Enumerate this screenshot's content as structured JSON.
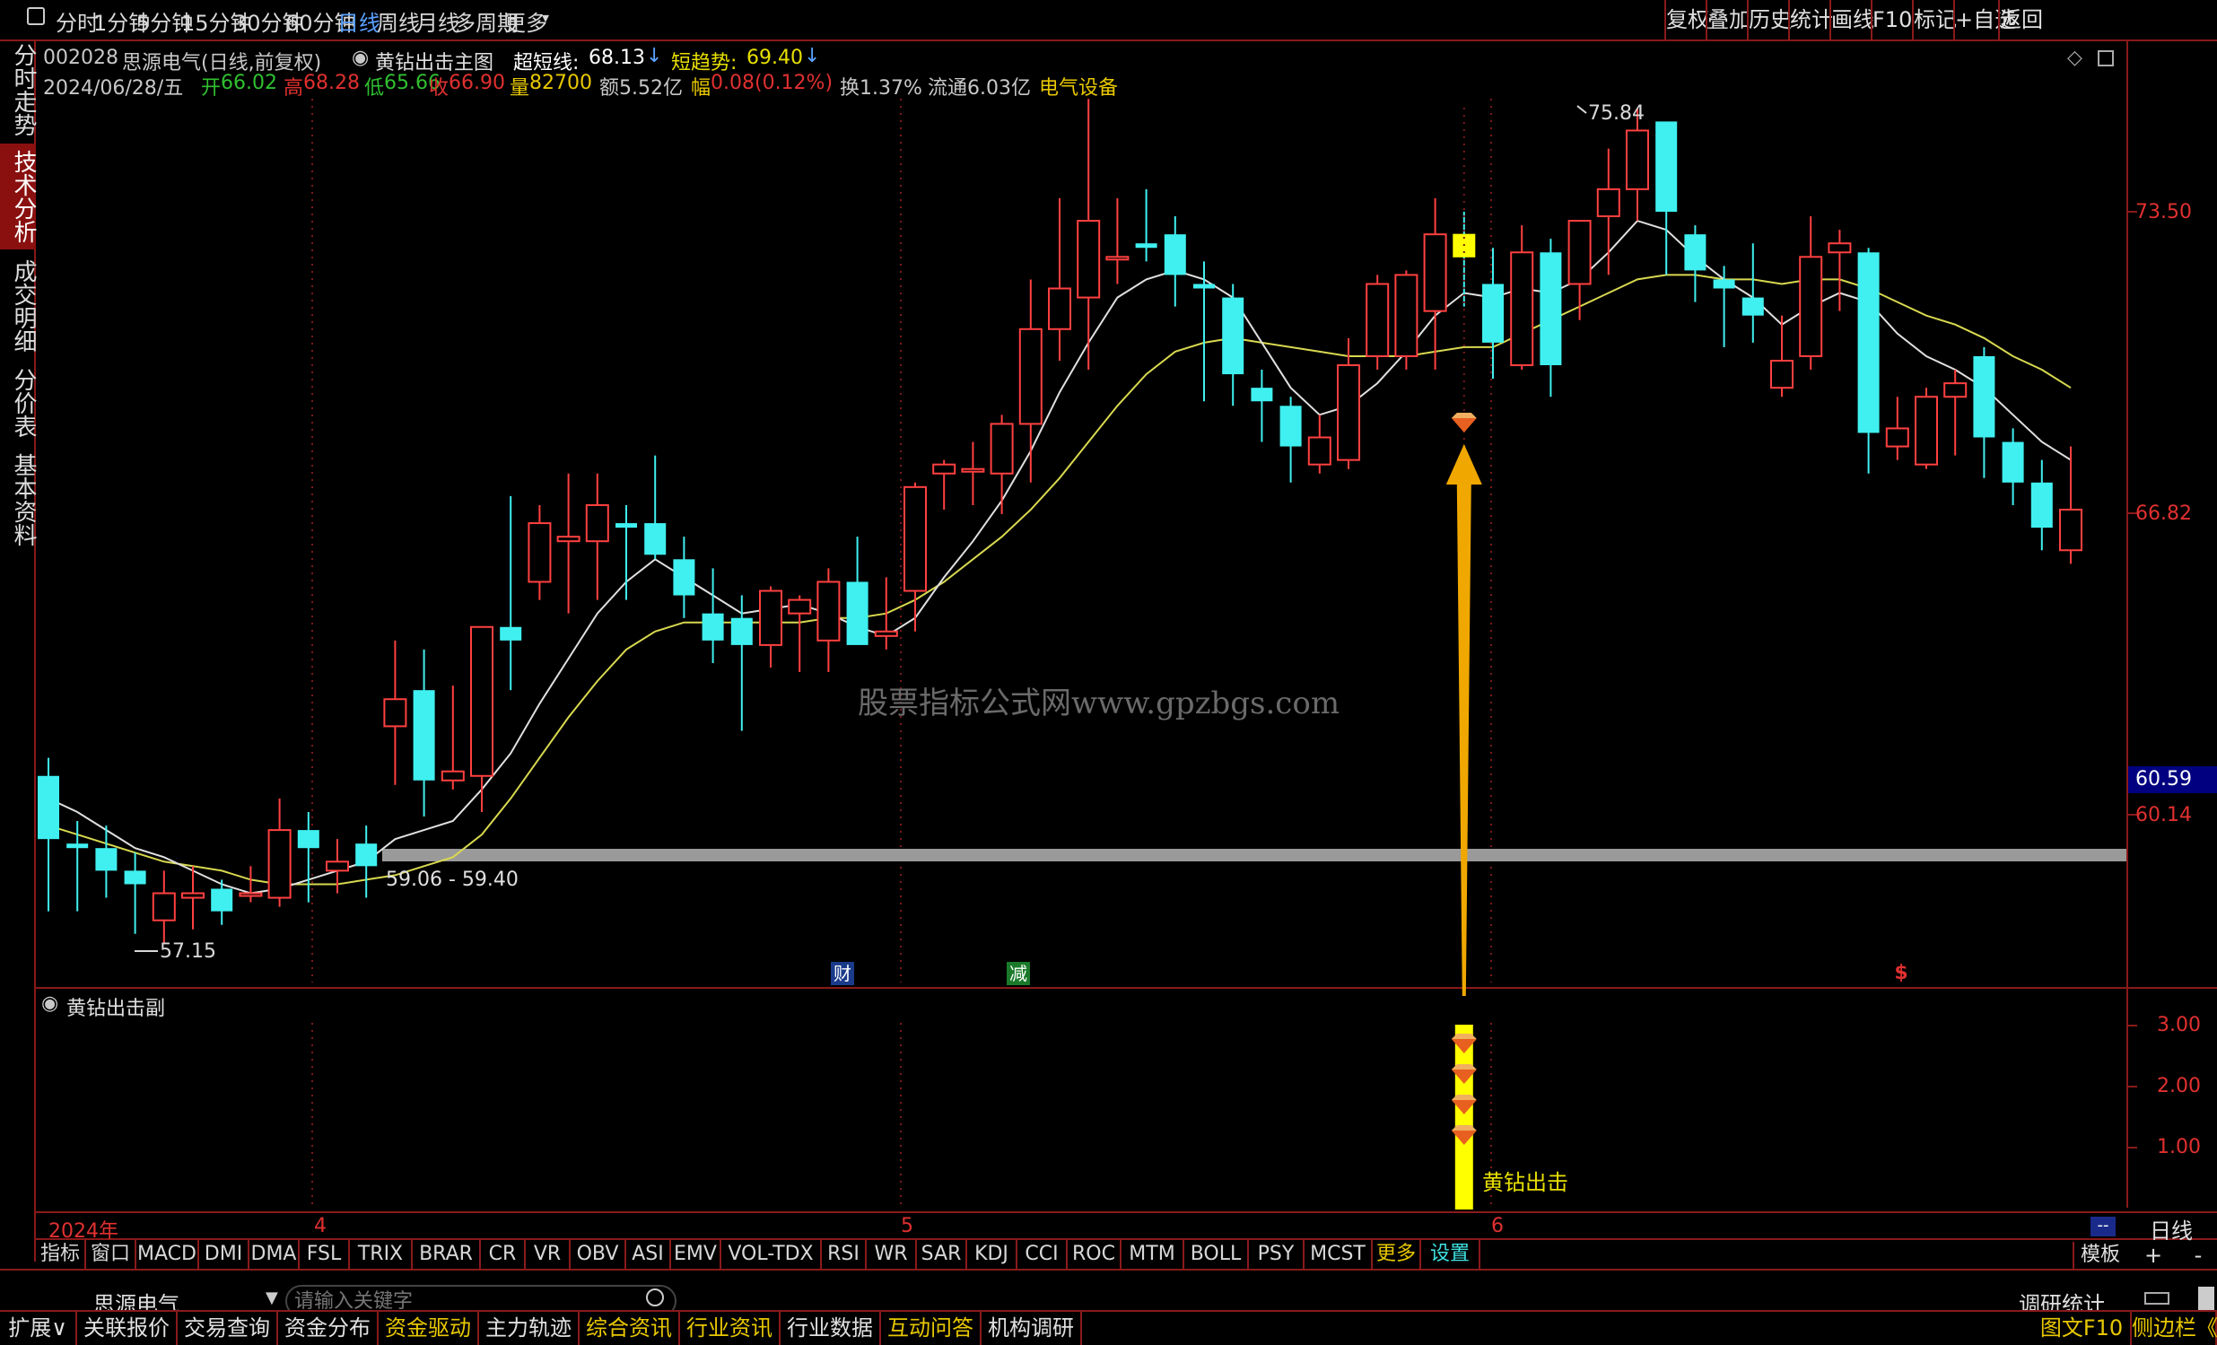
{
  "topbar": {
    "periods": [
      "分时",
      "1分钟",
      "5分钟",
      "15分钟",
      "30分钟",
      "60分钟",
      "日线",
      "周线",
      "月线",
      "多周期",
      "更多"
    ],
    "active_period": "日线",
    "more_arrow": "▾",
    "right_buttons": [
      "复权",
      "叠加",
      "历史",
      "统计",
      "画线",
      "F10",
      "标记",
      "+自选",
      "返回"
    ]
  },
  "sidebar": {
    "items": [
      "分时走势",
      "技术分析",
      "成交明细",
      "分价表",
      "基本资料"
    ],
    "active": "技术分析"
  },
  "stock": {
    "code": "002028",
    "name": "思源电气",
    "mode": "(日线,前复权)",
    "indicator": "黄钻出击主图",
    "ultra_short_label": "超短线:",
    "ultra_short_value": "68.13",
    "short_trend_label": "短趋势:",
    "short_trend_value": "69.40"
  },
  "quote": {
    "date": "2024/06/28/五",
    "open_label": "开",
    "open": "66.02",
    "high_label": "高",
    "high": "68.28",
    "low_label": "低",
    "low": "65.66",
    "close_label": "收",
    "close": "66.90",
    "vol_label": "量",
    "vol": "82700",
    "amount_label": "额",
    "amount": "5.52亿",
    "change_label": "幅",
    "change": "0.08(0.12%)",
    "turnover": "换1.37%",
    "float": "流通6.03亿",
    "sector": "电气设备"
  },
  "main_chart": {
    "y_labels": [
      "73.50",
      "66.82",
      "60.14"
    ],
    "current_price": "60.59",
    "high_marker": "75.84",
    "low_marker": "57.15",
    "range_label": "59.06 - 59.40",
    "watermark": "股票指标公式网www.gpzbgs.com",
    "event_tags": [
      "财",
      "减",
      "$"
    ]
  },
  "sub_chart": {
    "title": "黄钻出击副",
    "y_labels": [
      "3.00",
      "2.00",
      "1.00"
    ],
    "signal_label": "黄钻出击"
  },
  "time_axis": {
    "year": "2024年",
    "months": [
      "4",
      "5",
      "6"
    ],
    "period_label": "日线",
    "dash": "--"
  },
  "indicator_bar": {
    "items": [
      "指标",
      "窗口",
      "MACD",
      "DMI",
      "DMA",
      "FSL",
      "TRIX",
      "BRAR",
      "CR",
      "VR",
      "OBV",
      "ASI",
      "EMV",
      "VOL-TDX",
      "RSI",
      "WR",
      "SAR",
      "KDJ",
      "CCI",
      "ROC",
      "MTM",
      "BOLL",
      "PSY",
      "MCST",
      "更多",
      "设置"
    ],
    "template": "模板",
    "plus": "+",
    "minus": "-"
  },
  "search": {
    "stock_name": "思源电气",
    "placeholder": "请输入关键字",
    "right_label": "调研统计"
  },
  "bottom_tabs": {
    "expand": "扩展∨",
    "items": [
      "关联报价",
      "交易查询",
      "资金分布",
      "资金驱动",
      "主力轨迹",
      "综合资讯",
      "行业资讯",
      "行业数据",
      "互动问答",
      "机构调研"
    ],
    "right": [
      "图文F10",
      "侧边栏《"
    ]
  },
  "chart_data": {
    "type": "candlestick",
    "y_range": [
      56.5,
      77.0
    ],
    "candles": [
      {
        "o": 61.0,
        "h": 61.4,
        "l": 58.0,
        "c": 59.6
      },
      {
        "o": 59.5,
        "h": 60.0,
        "l": 58.0,
        "c": 59.4
      },
      {
        "o": 59.4,
        "h": 59.9,
        "l": 58.3,
        "c": 58.9
      },
      {
        "o": 58.9,
        "h": 59.3,
        "l": 57.5,
        "c": 58.6
      },
      {
        "o": 57.8,
        "h": 58.9,
        "l": 57.3,
        "c": 58.4
      },
      {
        "o": 58.3,
        "h": 59.0,
        "l": 57.6,
        "c": 58.4
      },
      {
        "o": 58.5,
        "h": 58.7,
        "l": 57.7,
        "c": 58.0
      },
      {
        "o": 58.4,
        "h": 59.0,
        "l": 58.2,
        "c": 58.4
      },
      {
        "o": 58.3,
        "h": 60.5,
        "l": 58.1,
        "c": 59.8
      },
      {
        "o": 59.8,
        "h": 60.2,
        "l": 58.2,
        "c": 59.4
      },
      {
        "o": 58.9,
        "h": 59.6,
        "l": 58.4,
        "c": 59.1
      },
      {
        "o": 59.5,
        "h": 59.9,
        "l": 58.3,
        "c": 59.0
      },
      {
        "o": 62.1,
        "h": 64.0,
        "l": 60.8,
        "c": 62.7
      },
      {
        "o": 62.9,
        "h": 63.8,
        "l": 60.1,
        "c": 60.9
      },
      {
        "o": 60.9,
        "h": 63.0,
        "l": 60.7,
        "c": 61.1
      },
      {
        "o": 61.0,
        "h": 64.2,
        "l": 60.2,
        "c": 64.3
      },
      {
        "o": 64.3,
        "h": 67.2,
        "l": 62.9,
        "c": 64.0
      },
      {
        "o": 65.3,
        "h": 67.0,
        "l": 64.9,
        "c": 66.6
      },
      {
        "o": 66.2,
        "h": 67.7,
        "l": 64.6,
        "c": 66.3
      },
      {
        "o": 66.2,
        "h": 67.7,
        "l": 64.9,
        "c": 67.0
      },
      {
        "o": 66.6,
        "h": 67.0,
        "l": 64.9,
        "c": 66.5
      },
      {
        "o": 66.6,
        "h": 68.1,
        "l": 65.8,
        "c": 65.9
      },
      {
        "o": 65.8,
        "h": 66.3,
        "l": 64.5,
        "c": 65.0
      },
      {
        "o": 64.6,
        "h": 65.6,
        "l": 63.5,
        "c": 64.0
      },
      {
        "o": 64.5,
        "h": 65.0,
        "l": 62.0,
        "c": 63.9
      },
      {
        "o": 63.9,
        "h": 65.2,
        "l": 63.4,
        "c": 65.1
      },
      {
        "o": 64.6,
        "h": 65.0,
        "l": 63.3,
        "c": 64.9
      },
      {
        "o": 64.0,
        "h": 65.6,
        "l": 63.3,
        "c": 65.3
      },
      {
        "o": 65.3,
        "h": 66.3,
        "l": 64.0,
        "c": 63.9
      },
      {
        "o": 64.1,
        "h": 65.4,
        "l": 63.8,
        "c": 64.2
      },
      {
        "o": 65.1,
        "h": 67.5,
        "l": 64.2,
        "c": 67.4
      },
      {
        "o": 67.7,
        "h": 68.0,
        "l": 66.9,
        "c": 67.9
      },
      {
        "o": 67.8,
        "h": 68.4,
        "l": 67.0,
        "c": 67.8
      },
      {
        "o": 67.7,
        "h": 69.0,
        "l": 66.8,
        "c": 68.8
      },
      {
        "o": 68.8,
        "h": 72.0,
        "l": 67.5,
        "c": 70.9
      },
      {
        "o": 70.9,
        "h": 73.8,
        "l": 70.2,
        "c": 71.8
      },
      {
        "o": 71.6,
        "h": 76.0,
        "l": 70.0,
        "c": 73.3
      },
      {
        "o": 72.5,
        "h": 73.8,
        "l": 71.9,
        "c": 72.5
      },
      {
        "o": 72.8,
        "h": 74.0,
        "l": 72.4,
        "c": 72.7
      },
      {
        "o": 73.0,
        "h": 73.4,
        "l": 71.4,
        "c": 72.1
      },
      {
        "o": 71.9,
        "h": 72.4,
        "l": 69.3,
        "c": 71.8
      },
      {
        "o": 71.6,
        "h": 71.9,
        "l": 69.2,
        "c": 69.9
      },
      {
        "o": 69.6,
        "h": 70.0,
        "l": 68.4,
        "c": 69.3
      },
      {
        "o": 69.2,
        "h": 69.4,
        "l": 67.5,
        "c": 68.3
      },
      {
        "o": 67.9,
        "h": 69.0,
        "l": 67.7,
        "c": 68.5
      },
      {
        "o": 68.0,
        "h": 70.7,
        "l": 67.8,
        "c": 70.1
      },
      {
        "o": 70.3,
        "h": 72.1,
        "l": 70.0,
        "c": 71.9
      },
      {
        "o": 70.3,
        "h": 72.2,
        "l": 70.0,
        "c": 72.1
      },
      {
        "o": 71.3,
        "h": 73.8,
        "l": 70.0,
        "c": 73.0
      },
      {
        "o": 73.0,
        "h": 73.5,
        "l": 71.4,
        "c": 72.5
      },
      {
        "o": 71.9,
        "h": 72.7,
        "l": 69.8,
        "c": 70.6
      },
      {
        "o": 70.1,
        "h": 73.2,
        "l": 70.0,
        "c": 72.6
      },
      {
        "o": 72.6,
        "h": 72.9,
        "l": 69.4,
        "c": 70.1
      },
      {
        "o": 71.9,
        "h": 73.3,
        "l": 71.1,
        "c": 73.3
      },
      {
        "o": 73.4,
        "h": 74.9,
        "l": 72.1,
        "c": 74.0
      },
      {
        "o": 74.0,
        "h": 75.8,
        "l": 73.3,
        "c": 75.3
      },
      {
        "o": 75.5,
        "h": 75.3,
        "l": 72.1,
        "c": 73.5
      },
      {
        "o": 73.0,
        "h": 73.2,
        "l": 71.5,
        "c": 72.2
      },
      {
        "o": 72.0,
        "h": 72.3,
        "l": 70.5,
        "c": 71.8
      },
      {
        "o": 71.6,
        "h": 72.8,
        "l": 70.6,
        "c": 71.2
      },
      {
        "o": 69.6,
        "h": 71.2,
        "l": 69.4,
        "c": 70.2
      },
      {
        "o": 70.3,
        "h": 73.4,
        "l": 70.0,
        "c": 72.5
      },
      {
        "o": 72.6,
        "h": 73.1,
        "l": 71.3,
        "c": 72.8
      },
      {
        "o": 72.6,
        "h": 72.7,
        "l": 67.7,
        "c": 68.6
      },
      {
        "o": 68.3,
        "h": 69.4,
        "l": 68.0,
        "c": 68.7
      },
      {
        "o": 67.9,
        "h": 69.6,
        "l": 67.8,
        "c": 69.4
      },
      {
        "o": 69.4,
        "h": 70.0,
        "l": 68.1,
        "c": 69.7
      },
      {
        "o": 70.3,
        "h": 70.5,
        "l": 67.6,
        "c": 68.5
      },
      {
        "o": 68.4,
        "h": 68.7,
        "l": 67.0,
        "c": 67.5
      },
      {
        "o": 67.5,
        "h": 68.0,
        "l": 66.0,
        "c": 66.5
      },
      {
        "o": 66.0,
        "h": 68.3,
        "l": 65.7,
        "c": 66.9
      }
    ],
    "ma_white": [
      60.5,
      60.2,
      59.8,
      59.4,
      59.2,
      58.9,
      58.6,
      58.4,
      58.5,
      58.7,
      58.9,
      59.1,
      59.6,
      59.8,
      60.0,
      60.7,
      61.5,
      62.6,
      63.6,
      64.6,
      65.3,
      65.8,
      65.4,
      65.0,
      64.6,
      64.7,
      64.8,
      64.6,
      64.3,
      64.1,
      64.5,
      65.4,
      66.2,
      67.1,
      68.2,
      69.5,
      70.6,
      71.6,
      72.0,
      72.2,
      72.0,
      71.6,
      70.6,
      69.6,
      69.0,
      69.2,
      69.7,
      70.4,
      71.2,
      71.7,
      71.6,
      71.8,
      71.7,
      72.0,
      72.6,
      73.3,
      73.1,
      72.5,
      72.0,
      71.6,
      71.0,
      71.4,
      71.7,
      71.5,
      70.8,
      70.3,
      70.0,
      69.6,
      69.0,
      68.4,
      68.0
    ],
    "ma_yellow": [
      59.9,
      59.7,
      59.5,
      59.3,
      59.1,
      59.0,
      58.9,
      58.7,
      58.6,
      58.6,
      58.6,
      58.7,
      58.8,
      59.0,
      59.2,
      59.7,
      60.5,
      61.4,
      62.3,
      63.1,
      63.8,
      64.2,
      64.4,
      64.4,
      64.4,
      64.4,
      64.4,
      64.5,
      64.5,
      64.6,
      64.9,
      65.3,
      65.8,
      66.3,
      66.9,
      67.6,
      68.4,
      69.2,
      69.9,
      70.4,
      70.6,
      70.7,
      70.6,
      70.5,
      70.4,
      70.3,
      70.3,
      70.3,
      70.4,
      70.5,
      70.5,
      70.8,
      71.1,
      71.4,
      71.7,
      72.0,
      72.1,
      72.1,
      72.0,
      72.0,
      71.9,
      72.0,
      72.0,
      71.8,
      71.5,
      71.2,
      71.0,
      70.7,
      70.3,
      70.0,
      69.6
    ],
    "signal_bar_index": 49,
    "horizontal_band": [
      59.06,
      59.4
    ]
  }
}
